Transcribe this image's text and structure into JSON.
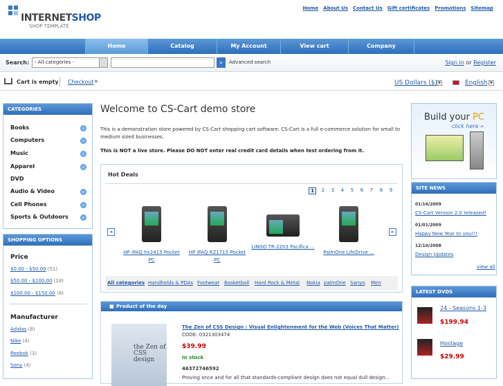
{
  "logo": {
    "brand_a": "INTERNET",
    "brand_b": "SHOP",
    "subtitle": "SHOP TEMPLATE"
  },
  "toplinks": [
    "Home",
    "About Us",
    "Contact Us",
    "Gift certificates",
    "Promotions",
    "Sitemap"
  ],
  "nav": [
    "Home",
    "Catalog",
    "My Account",
    "View cart",
    "Company"
  ],
  "search": {
    "label": "Search:",
    "category": "- All categories -",
    "query": "",
    "advanced": "Advanced search"
  },
  "account": {
    "signin": "Sign in",
    "or": "or",
    "register": "Register"
  },
  "cart": {
    "status": "Cart is empty",
    "checkout": "Checkout",
    "raquo": "»",
    "currency": "US Dollars ($)",
    "language": "English"
  },
  "categories": {
    "title": "CATEGORIES",
    "items": [
      "Books",
      "Computers",
      "Music",
      "Apparel",
      "DVD",
      "Audio & Video",
      "Cell Phones",
      "Sports & Outdoors"
    ]
  },
  "shopping_options": {
    "title": "SHOPPING OPTIONS",
    "price_heading": "Price",
    "prices": [
      {
        "label": "$0.00 - $50.00",
        "count": "(51)"
      },
      {
        "label": "$50.00 - $100.00",
        "count": "(18)"
      },
      {
        "label": "$100.00 - $150.00",
        "count": "(8)"
      }
    ],
    "manufacturer_heading": "Manufacturer",
    "manufacturers": [
      {
        "label": "Adidas",
        "count": "(8)"
      },
      {
        "label": "Nike",
        "count": "(4)"
      },
      {
        "label": "Reebok",
        "count": "(3)"
      },
      {
        "label": "Sony",
        "count": "(4)"
      }
    ]
  },
  "main": {
    "title": "Welcome to CS-Cart demo store",
    "intro": "This is a demonstration store powered by CS-Cart shopping cart software. CS-Cart is a full e-commerce solution for small to medium sized businesses.",
    "warning": "This is NOT a live store. Please DO NOT enter real credit card details when test ordering from it."
  },
  "hot_deals": {
    "title": "Hot Deals",
    "pages": [
      "1",
      "2",
      "3",
      "4",
      "5",
      "6",
      "7",
      "8",
      "9"
    ],
    "prev": "◂",
    "next": "▸",
    "products": [
      "HP iPAQ hx2415 Pocket PC",
      "HP iPAQ RZ1715 Pocket PC",
      "LINGO TR-2203 Pacifica ...",
      "PalmOne LifeDrive ..."
    ],
    "filters": [
      "All categories",
      "Handhelds & PDAs",
      "Footwear",
      "Basketball",
      "Hard Rock & Metal",
      "Nokia",
      "palmOne",
      "Sanyo",
      "Men"
    ]
  },
  "product_of_day": {
    "title": "Product of the day",
    "book_cover": "the Zen of CSS design",
    "name": "The Zen of CSS Design : Visual Enlightenment for the Web (Voices That Matter)",
    "code": "CODE: 0321303474",
    "price": "$39.99",
    "stock": "In stock",
    "isbn": "46372746592",
    "desc": "Proving once and for all that standards-compliant design does not equal dull design..."
  },
  "build_pc": {
    "title_a": "Build your ",
    "title_b": "PC",
    "click": "click here »"
  },
  "news": {
    "title": "SITE NEWS",
    "items": [
      {
        "date": "01/16/2009",
        "text": "CS-Cart Version 2.0 released!"
      },
      {
        "date": "01/01/2009",
        "text": "Happy New Year to you!!!"
      },
      {
        "date": "12/10/2008",
        "text": "Design Updates"
      }
    ],
    "view_all": "view all"
  },
  "dvds": {
    "title": "LATEST DVDS",
    "items": [
      {
        "name": "24 - Seasons 1-3",
        "price": "$199.94"
      },
      {
        "name": "Hostage",
        "price": "$29.99"
      }
    ]
  }
}
